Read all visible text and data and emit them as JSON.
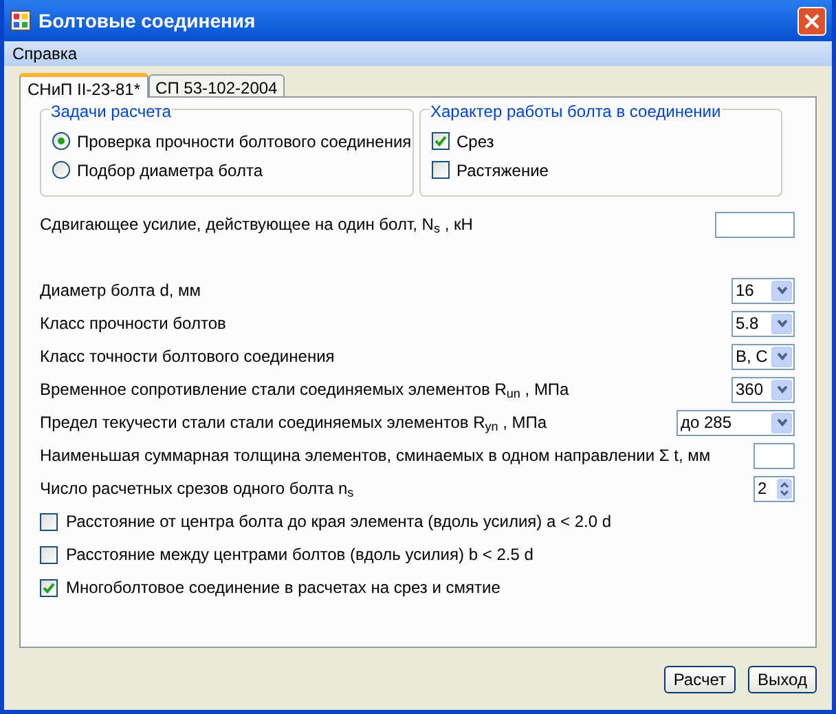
{
  "window": {
    "title": "Болтовые соединения"
  },
  "menu": [
    "Справка"
  ],
  "tabs": [
    {
      "label": "СНиП II-23-81*",
      "selected": true
    },
    {
      "label": "СП 53-102-2004",
      "selected": false
    }
  ],
  "task_group": {
    "title": "Задачи расчета",
    "options": [
      {
        "label": "Проверка прочности болтового соединения",
        "selected": true
      },
      {
        "label": "Подбор диаметра болта",
        "selected": false
      }
    ]
  },
  "work_group": {
    "title": "Характер работы болта в соединении",
    "options": [
      {
        "label": "Срез",
        "checked": true
      },
      {
        "label": "Растяжение",
        "checked": false
      }
    ]
  },
  "rows": [
    {
      "kind": "text_input",
      "label": "Сдвигающее усилие, действующее на один болт, N$_{s}$ , кН"
    },
    {
      "kind": "combo",
      "label": "Диаметр болта d, мм",
      "value": "16"
    },
    {
      "kind": "combo",
      "label": "Класс прочности болтов",
      "value": "5.8"
    },
    {
      "kind": "combo",
      "label": "Класс точности болтового соединения",
      "value": "B, C"
    },
    {
      "kind": "combo",
      "label": "Временное сопротивление стали соединяемых элементов R$_{un}$ , МПа",
      "value": "360"
    },
    {
      "kind": "combo",
      "label": "Предел текучести стали стали соединяемых элементов R$_{yn}$ , МПа",
      "value": "до 285"
    },
    {
      "kind": "text_input",
      "label": "Наименьшая суммарная толщина элементов, сминаемых в одном направлении  Σ t, мм"
    },
    {
      "kind": "spin",
      "label": "Число расчетных срезов одного болта n$_{s}$",
      "value": "2"
    },
    {
      "kind": "checkbox",
      "label": "Расстояние от центра болта до края элемента (вдоль усилия) a < 2.0 d",
      "checked": false
    },
    {
      "kind": "checkbox",
      "label": "Расстояние между центрами болтов (вдоль усилия) b < 2.5 d",
      "checked": false
    },
    {
      "kind": "checkbox",
      "label": "Многоболтовое соединение в расчетах на срез и смятие",
      "checked": true
    }
  ],
  "buttons": [
    "Расчет",
    "Выход"
  ]
}
